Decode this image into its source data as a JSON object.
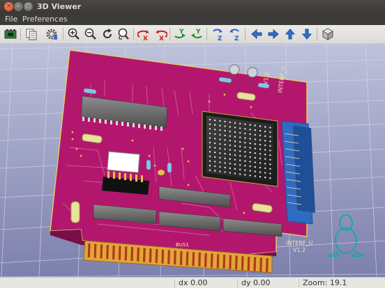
{
  "window": {
    "title": "3D Viewer",
    "controls": {
      "close": "×",
      "minimize": "–",
      "maximize": "□"
    }
  },
  "menubar": {
    "items": [
      "File",
      "Preferences"
    ]
  },
  "toolbar": {
    "tools": [
      "reload-board-icon",
      "copy-to-clipboard-icon",
      "settings-icon",
      "zoom-in-icon",
      "zoom-out-icon",
      "redraw-icon",
      "zoom-auto-icon",
      "rotate-x-cw-icon",
      "rotate-x-ccw-icon",
      "rotate-y-cw-icon",
      "rotate-y-ccw-icon",
      "rotate-z-cw-icon",
      "rotate-z-ccw-icon",
      "move-left-icon",
      "move-right-icon",
      "move-up-icon",
      "move-down-icon",
      "ortho-view-icon"
    ],
    "axis_letters": {
      "x": "X",
      "y": "Y",
      "z": "Z"
    },
    "colors": {
      "rotate_x": "#cc2020",
      "rotate_y": "#1f8f1f",
      "rotate_z": "#2a62c9",
      "arrows": "#2f6fcf"
    }
  },
  "viewport": {
    "colors": {
      "background_top": "#b9bdd8",
      "background_bottom": "#7e82ae",
      "board": "#b5176e",
      "copper": "#d9ba3f",
      "grid": "#d7d9ea"
    },
    "silkscreen": [
      "INTERF_U",
      "V1.2",
      "INTERF_U",
      "V1.2",
      "BUS1"
    ]
  },
  "statusbar": {
    "dx": "dx 0.00",
    "dy": "dy 0.00",
    "zoom": "Zoom: 19.1"
  }
}
